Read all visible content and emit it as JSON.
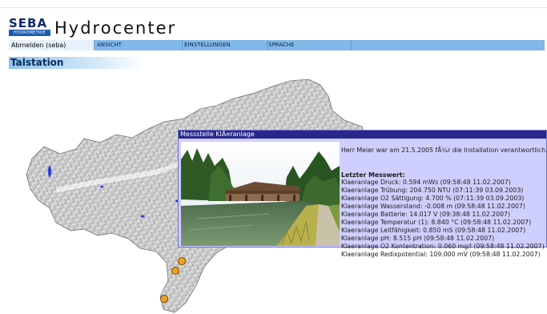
{
  "app": {
    "logo_text": "SEBA",
    "logo_subtext": "HYDROMETRIE",
    "title": "Hydrocenter"
  },
  "nav": {
    "user_label": "Abmelden (seba)",
    "items": [
      "ANSICHT",
      "EINSTELLUNGEN",
      "SPRACHE"
    ]
  },
  "page": {
    "section_title": "Talstation"
  },
  "popup": {
    "title": "Messstelle KlÃ¤ranlage",
    "note": "Herr Meier war am 21.5.2005 fÃ¼r die Installation verantwortlich.",
    "last_value_label": "Letzter Messwert:",
    "measurements": [
      "Klaeranlage Druck: 0.594 mWs (09:58:48 11.02.2007)",
      "Klaeranlage Trübung: 204.750 NTU (07:11:39 03.09.2003)",
      "Klaeranlage O2 Sättigung: 4.700 % (07:11:39 03.09.2003)",
      "Klaeranlage Wasserstand: -0.008 m (09:58:48 11.02.2007)",
      "Klaeranlage Batterie: 14.017 V (09:38:48 11.02.2007)",
      "Klaeranlage Temperatur (1): 8.840 °C (09:58:48 11.02.2007)",
      "Klaeranlage Leitfähigkeit: 0.850 mS (09:58:48 11.02.2007)",
      "Klaeranlage pH: 8.515 pH (09:58:48 11.02.2007)",
      "Klaeranlage O2 Kontentration: 0.060 mg/l (09:58:48 11.02.2007)",
      "Klaeranlage Redixpotential: 109.000 mV (09:58:48 11.02.2007)"
    ]
  },
  "colors": {
    "navbar": "#80b8e8",
    "popup_bg": "#cfcfff",
    "popup_header": "#28288c",
    "station_marker": "#f0a020"
  }
}
